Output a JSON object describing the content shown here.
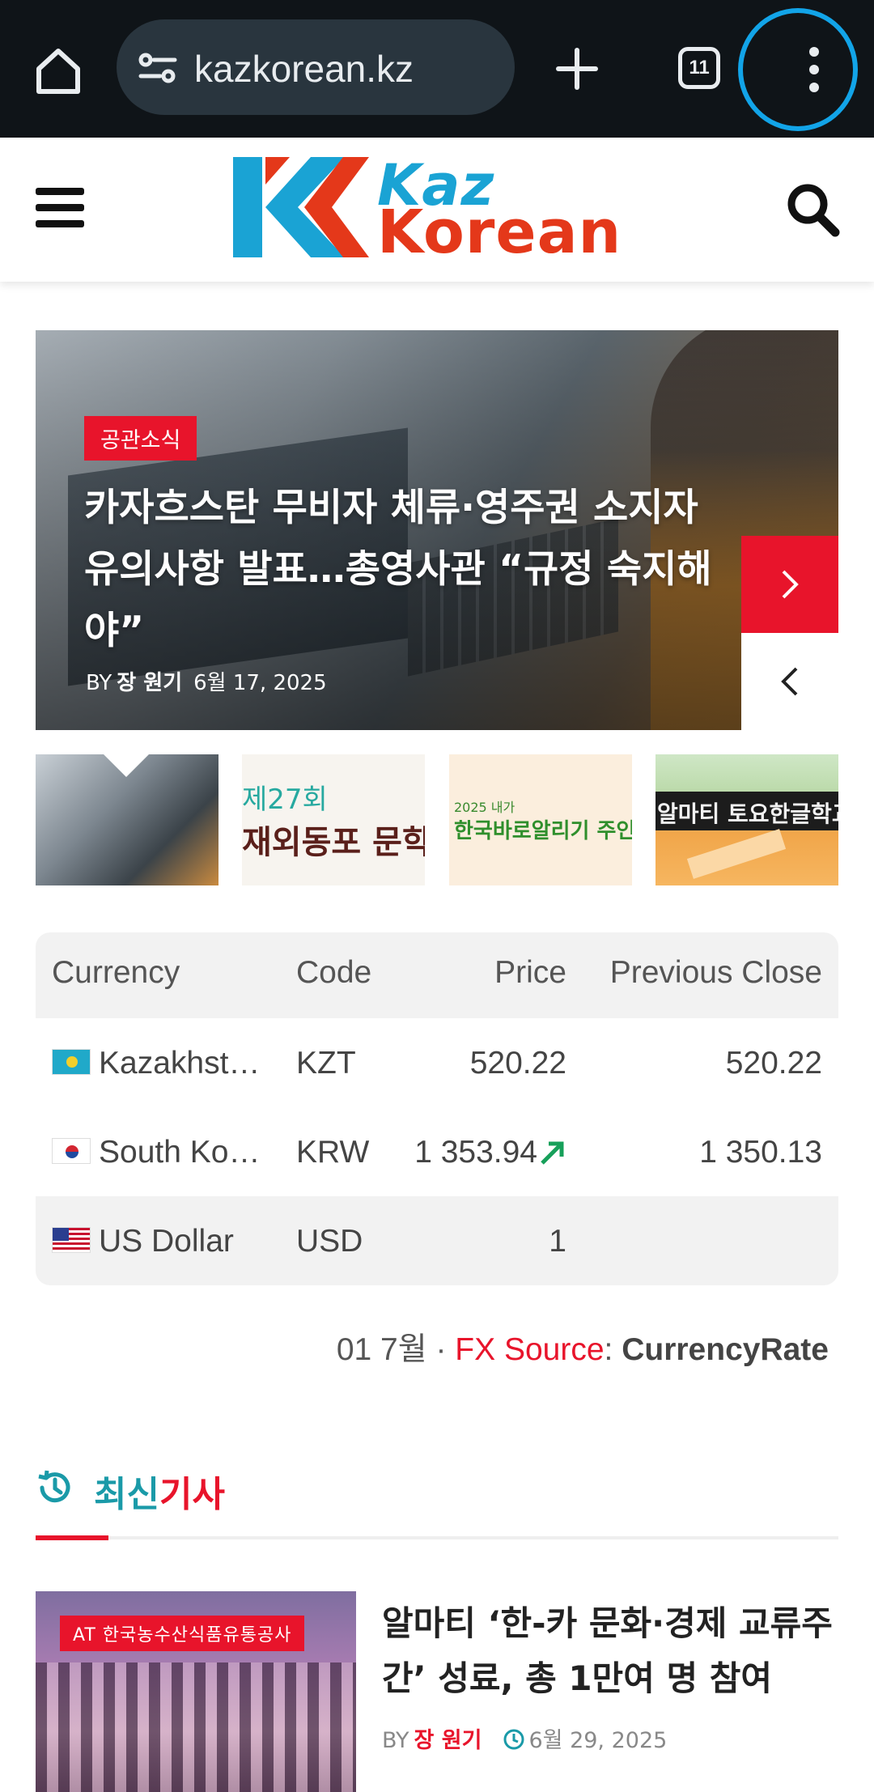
{
  "browser": {
    "url": "kazkorean.kz",
    "tab_count": "11"
  },
  "site": {
    "logo_line1": "Kaz",
    "logo_line2": "Korean"
  },
  "slider": {
    "category": "공관소식",
    "headline": "카자흐스탄 무비자 체류·영주권 소지자 유의사항 발표…총영사관 “규정 숙지해야”",
    "by_label": "BY",
    "author": "장 원기",
    "date": "6월 17, 2025"
  },
  "thumbnails": [
    {
      "line1": "",
      "line2": ""
    },
    {
      "line1": "제27회",
      "line2": "재외동포 문학상"
    },
    {
      "line1": "2025 내가",
      "line2": "한국바로알리기 주인공"
    },
    {
      "line1": "알마티 토요한글학교",
      "line2": ""
    }
  ],
  "currency_table": {
    "headers": {
      "currency": "Currency",
      "code": "Code",
      "price": "Price",
      "previous_close": "Previous Close"
    },
    "rows": [
      {
        "currency": "Kazakhst…",
        "flag": "kz",
        "code": "KZT",
        "price": "520.22",
        "previous_close": "520.22",
        "trend": ""
      },
      {
        "currency": "South Ko…",
        "flag": "kr",
        "code": "KRW",
        "price": "1 353.94",
        "previous_close": "1 350.13",
        "trend": "up"
      },
      {
        "currency": "US Dollar",
        "flag": "us",
        "code": "USD",
        "price": "1",
        "previous_close": "",
        "trend": ""
      }
    ],
    "footer_date": "01 7월 · ",
    "footer_source_label": "FX Source",
    "footer_colon": ": ",
    "footer_source_name": "CurrencyRate"
  },
  "latest": {
    "title_part1": "최신",
    "title_part2": "기사"
  },
  "article": {
    "image_badge": "AT 한국농수산식품유통공사",
    "title": "알마티 ‘한-카 문화·경제 교류주간’ 성료, 총 1만여 명 참여",
    "by_label": "BY",
    "author": "장 원기",
    "date": "6월 29, 2025"
  },
  "colors": {
    "accent_red": "#e8142b",
    "accent_teal": "#1a9aa8",
    "chrome_bg": "#0f1418",
    "highlight_ring": "#12a4e8"
  },
  "icons": [
    "home-icon",
    "site-settings-icon",
    "new-tab-icon",
    "tab-switcher-icon",
    "more-menu-icon",
    "hamburger-icon",
    "search-icon",
    "chevron-right-icon",
    "chevron-left-icon",
    "trend-up-icon",
    "history-icon",
    "clock-icon"
  ]
}
